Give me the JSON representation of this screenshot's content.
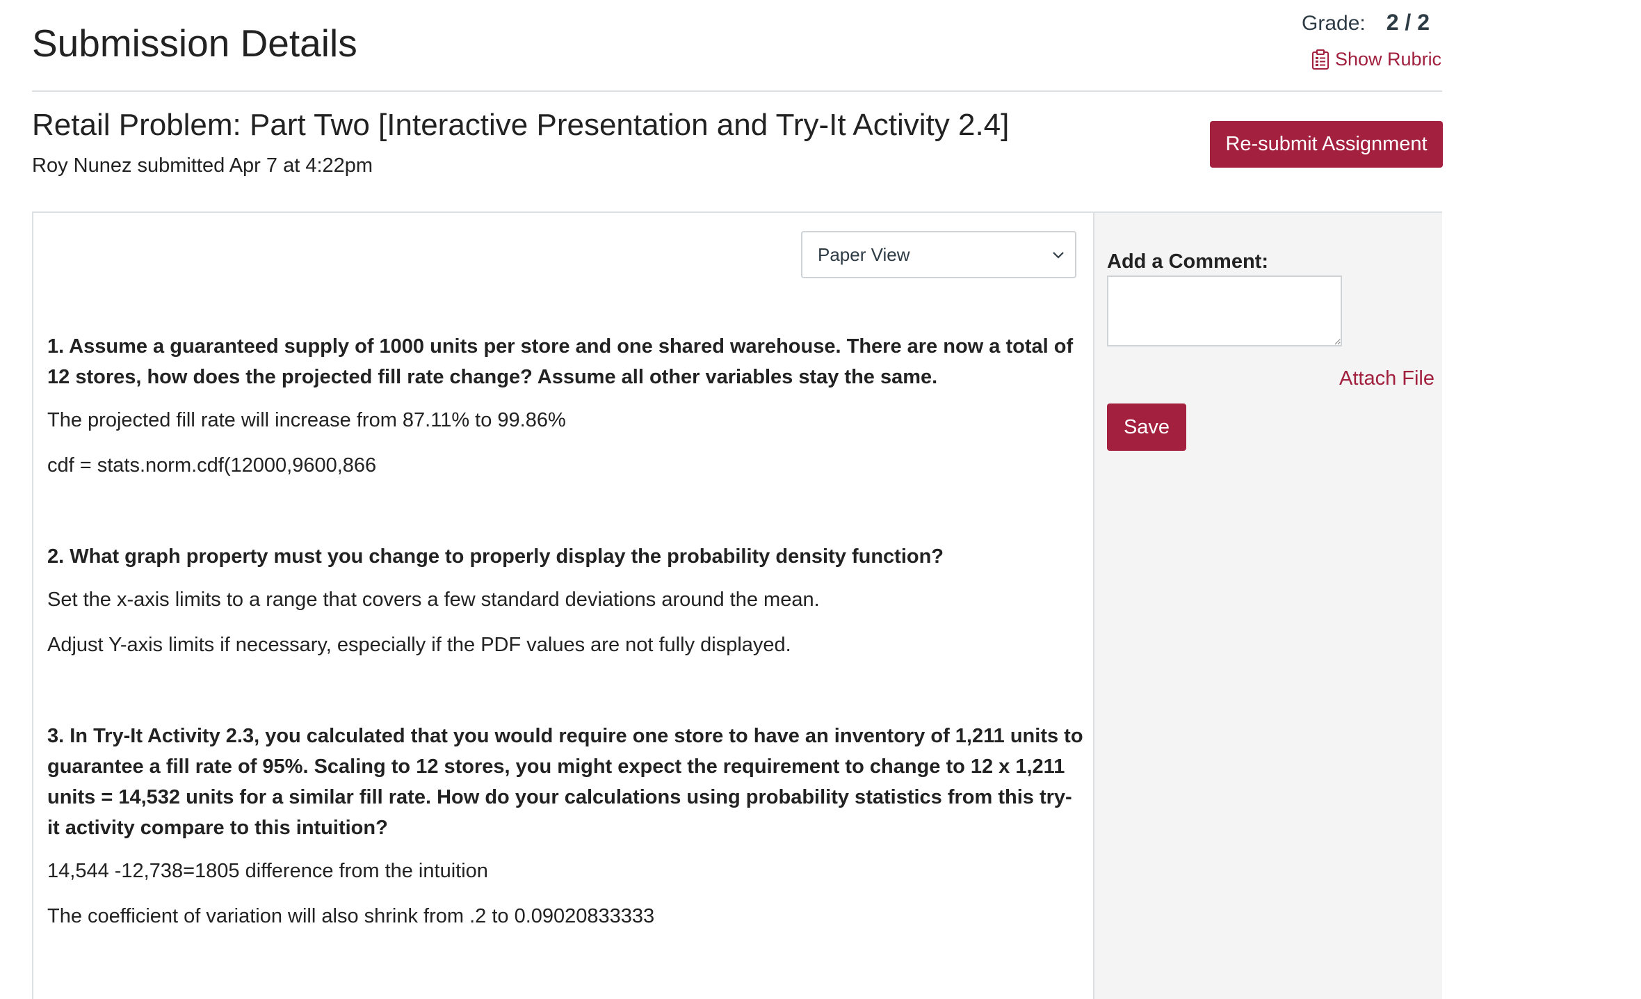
{
  "header": {
    "page_title": "Submission Details",
    "grade_label": "Grade:",
    "grade_value": "2 / 2",
    "show_rubric_label": "Show Rubric"
  },
  "assignment": {
    "title": "Retail Problem: Part Two [Interactive Presentation and Try-It Activity 2.4]",
    "submitter_line": "Roy Nunez submitted Apr 7 at 4:22pm",
    "resubmit_label": "Re-submit Assignment"
  },
  "viewer": {
    "view_select_value": "Paper View"
  },
  "answers": [
    {
      "question": "1. Assume a guaranteed supply of 1000 units per store and one shared warehouse. There are now a total of 12 stores, how does the projected fill rate change? Assume all other variables stay the same.",
      "responses": [
        "The projected fill rate will increase from 87.11% to 99.86%",
        "cdf = stats.norm.cdf(12000,9600,866"
      ]
    },
    {
      "question": "2. What graph property must you change to properly display the probability density function?",
      "responses": [
        "Set the x-axis limits to a range that covers a few standard deviations around the mean.",
        "Adjust Y-axis limits if necessary, especially if the PDF values are not fully displayed."
      ]
    },
    {
      "question": "3. In Try-It Activity 2.3, you calculated that you would require one store to have an inventory of 1,211 units to guarantee a fill rate of 95%. Scaling to 12 stores, you might expect the requirement to change to 12 x 1,211 units = 14,532 units for a similar fill rate. How do your calculations using probability statistics from this try-it activity compare to this intuition?",
      "responses": [
        "14,544 -12,738=1805 difference from the intuition",
        "The coefficient of variation will also shrink from .2 to 0.09020833333"
      ]
    }
  ],
  "comments": {
    "label": "Add a Comment:",
    "attach_label": "Attach File",
    "save_label": "Save"
  },
  "colors": {
    "accent": "#a3203f",
    "link": "#a1203e",
    "border": "#dcdfe2",
    "sidebar_bg": "#f4f4f5"
  }
}
